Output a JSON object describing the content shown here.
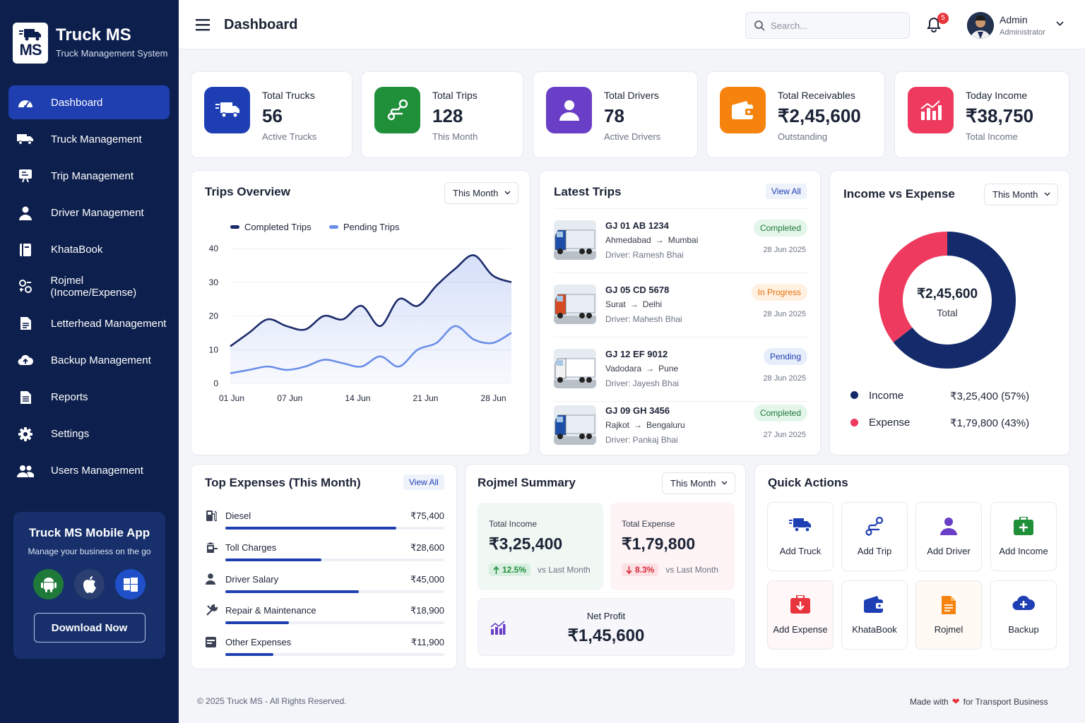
{
  "app": {
    "logo_text": "MS",
    "title": "Truck MS",
    "subtitle": "Truck Management System"
  },
  "sidebar": {
    "items": [
      {
        "label": "Dashboard",
        "icon": "dashboard-gauge-icon",
        "active": true
      },
      {
        "label": "Truck Management",
        "icon": "truck-icon"
      },
      {
        "label": "Trip Management",
        "icon": "trip-board-icon"
      },
      {
        "label": "Driver Management",
        "icon": "person-icon"
      },
      {
        "label": "KhataBook",
        "icon": "book-icon"
      },
      {
        "label": "Rojmel (Income/Expense)",
        "icon": "cash-flow-icon"
      },
      {
        "label": "Letterhead Management",
        "icon": "document-icon"
      },
      {
        "label": "Backup Management",
        "icon": "cloud-upload-icon"
      },
      {
        "label": "Reports",
        "icon": "report-icon"
      },
      {
        "label": "Settings",
        "icon": "gear-icon"
      },
      {
        "label": "Users Management",
        "icon": "users-icon"
      }
    ],
    "promo": {
      "title": "Truck MS Mobile App",
      "subtitle": "Manage your business on the go",
      "button": "Download Now"
    }
  },
  "header": {
    "page_title": "Dashboard",
    "search_placeholder": "Search...",
    "notification_count": "5",
    "user_name": "Admin",
    "user_role": "Administrator"
  },
  "stats": [
    {
      "label": "Total Trucks",
      "value": "56",
      "sub": "Active Trucks",
      "color": "#1e3fb4",
      "icon": "truck-icon"
    },
    {
      "label": "Total Trips",
      "value": "128",
      "sub": "This Month",
      "color": "#1f8f3a",
      "icon": "route-icon"
    },
    {
      "label": "Total Drivers",
      "value": "78",
      "sub": "Active Drivers",
      "color": "#6a3fc7",
      "icon": "person-icon"
    },
    {
      "label": "Total Receivables",
      "value": "₹2,45,600",
      "sub": "Outstanding",
      "color": "#f7830f",
      "icon": "wallet-icon"
    },
    {
      "label": "Today Income",
      "value": "₹38,750",
      "sub": "Total Income",
      "color": "#ee3a5e",
      "icon": "bar-chart-icon"
    }
  ],
  "trips_overview": {
    "title": "Trips Overview",
    "period": "This Month",
    "chart_data": {
      "type": "line",
      "x": [
        "01 Jun",
        "03 Jun",
        "05 Jun",
        "07 Jun",
        "09 Jun",
        "11 Jun",
        "13 Jun",
        "15 Jun",
        "17 Jun",
        "19 Jun",
        "21 Jun",
        "23 Jun",
        "25 Jun",
        "27 Jun",
        "28 Jun",
        "30 Jun"
      ],
      "xticks": [
        "01 Jun",
        "07 Jun",
        "14 Jun",
        "21 Jun",
        "28 Jun"
      ],
      "ylim": [
        0,
        40
      ],
      "yticks": [
        0,
        10,
        20,
        30,
        40
      ],
      "series": [
        {
          "name": "Completed Trips",
          "color": "#1b2a6b",
          "values": [
            11,
            15,
            19,
            17,
            16,
            20,
            19,
            23,
            17,
            25,
            23,
            29,
            34,
            38,
            32,
            30
          ]
        },
        {
          "name": "Pending Trips",
          "color": "#6b8ee8",
          "values": [
            3,
            4,
            5,
            4,
            5,
            7,
            6,
            5,
            8,
            5,
            10,
            12,
            17,
            13,
            12,
            15
          ]
        }
      ]
    }
  },
  "latest_trips": {
    "title": "Latest Trips",
    "view_all": "View All",
    "items": [
      {
        "number": "GJ 01 AB 1234",
        "from": "Ahmedabad",
        "to": "Mumbai",
        "driver": "Driver: Ramesh Bhai",
        "status": "Completed",
        "date": "28 Jun 2025",
        "cab_color": "#1e4fa8"
      },
      {
        "number": "GJ 05 CD 5678",
        "from": "Surat",
        "to": "Delhi",
        "driver": "Driver: Mahesh Bhai",
        "status": "In Progress",
        "date": "28 Jun 2025",
        "cab_color": "#d84a22"
      },
      {
        "number": "GJ 12 EF 9012",
        "from": "Vadodara",
        "to": "Pune",
        "driver": "Driver: Jayesh Bhai",
        "status": "Pending",
        "date": "28 Jun 2025",
        "cab_color": "#f2f2f2"
      },
      {
        "number": "GJ 09 GH 3456",
        "from": "Rajkot",
        "to": "Bengaluru",
        "driver": "Driver: Pankaj Bhai",
        "status": "Completed",
        "date": "27 Jun 2025",
        "cab_color": "#1e4fa8"
      }
    ]
  },
  "income_expense": {
    "title": "Income vs Expense",
    "period": "This Month",
    "center_value": "₹2,45,600",
    "center_label": "Total",
    "chart_data": {
      "type": "pie",
      "categories": [
        "Income",
        "Expense"
      ],
      "values": [
        325400,
        179800
      ],
      "percentages": [
        57,
        43
      ],
      "colors": [
        "#142a6b",
        "#ee3a5e"
      ]
    },
    "legend": [
      {
        "label": "Income",
        "value": "₹3,25,400 (57%)",
        "color": "#142a6b"
      },
      {
        "label": "Expense",
        "value": "₹1,79,800 (43%)",
        "color": "#ee3a5e"
      }
    ]
  },
  "top_expenses": {
    "title": "Top Expenses (This Month)",
    "view_all": "View All",
    "items": [
      {
        "label": "Diesel",
        "value": "₹75,400",
        "fraction": 0.78,
        "icon": "fuel-pump-icon"
      },
      {
        "label": "Toll Charges",
        "value": "₹28,600",
        "fraction": 0.44,
        "icon": "toll-booth-icon"
      },
      {
        "label": "Driver Salary",
        "value": "₹45,000",
        "fraction": 0.61,
        "icon": "person-icon"
      },
      {
        "label": "Repair & Maintenance",
        "value": "₹18,900",
        "fraction": 0.29,
        "icon": "wrench-icon"
      },
      {
        "label": "Other Expenses",
        "value": "₹11,900",
        "fraction": 0.22,
        "icon": "receipt-icon"
      }
    ]
  },
  "rojmel_summary": {
    "title": "Rojmel Summary",
    "period": "This Month",
    "income": {
      "label": "Total Income",
      "value": "₹3,25,400",
      "change": "12.5%",
      "compare": "vs Last Month"
    },
    "expense": {
      "label": "Total Expense",
      "value": "₹1,79,800",
      "change": "8.3%",
      "compare": "vs Last Month"
    },
    "net": {
      "label": "Net Profit",
      "value": "₹1,45,600"
    }
  },
  "quick_actions": {
    "title": "Quick Actions",
    "items": [
      {
        "label": "Add Truck",
        "icon": "truck-icon",
        "color": "#1e3fb4",
        "bg": "#ffffff"
      },
      {
        "label": "Add Trip",
        "icon": "route-icon",
        "color": "#1e3fb4",
        "bg": "#ffffff"
      },
      {
        "label": "Add Driver",
        "icon": "person-icon",
        "color": "#6a3fc7",
        "bg": "#ffffff"
      },
      {
        "label": "Add Income",
        "icon": "add-income-icon",
        "color": "#1f8f3a",
        "bg": "#ffffff"
      },
      {
        "label": "Add Expense",
        "icon": "add-expense-icon",
        "color": "#e8343c",
        "bg": "#fff7f8"
      },
      {
        "label": "KhataBook",
        "icon": "wallet-icon",
        "color": "#1e3fb4",
        "bg": "#ffffff"
      },
      {
        "label": "Rojmel",
        "icon": "document-icon",
        "color": "#f7830f",
        "bg": "#fffaf3"
      },
      {
        "label": "Backup",
        "icon": "cloud-add-icon",
        "color": "#1e3fb4",
        "bg": "#ffffff"
      }
    ]
  },
  "footer": {
    "copyright": "© 2025 Truck MS - All Rights Reserved.",
    "made_with": "Made with",
    "made_for": "for Transport Business"
  }
}
